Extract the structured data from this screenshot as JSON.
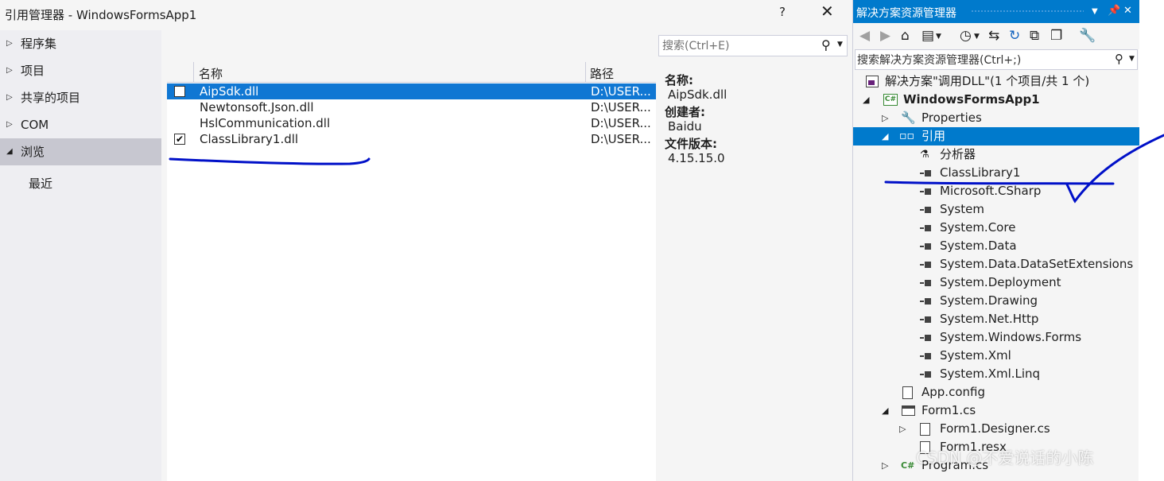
{
  "reference_manager": {
    "title": "引用管理器 - WindowsFormsApp1",
    "help_label": "?",
    "close_label": "✕",
    "nav": [
      {
        "label": "程序集",
        "arrow": "▷"
      },
      {
        "label": "项目",
        "arrow": "▷"
      },
      {
        "label": "共享的项目",
        "arrow": "▷"
      },
      {
        "label": "COM",
        "arrow": "▷"
      },
      {
        "label": "浏览",
        "arrow": "◢",
        "selected": true
      }
    ],
    "nav_sub": "最近",
    "columns": {
      "name": "名称",
      "path": "路径"
    },
    "rows": [
      {
        "name": "AipSdk.dll",
        "path": "D:\\USER...",
        "checked": false,
        "selected": true
      },
      {
        "name": "Newtonsoft.Json.dll",
        "path": "D:\\USER...",
        "checked": null,
        "selected": false
      },
      {
        "name": "HslCommunication.dll",
        "path": "D:\\USER...",
        "checked": null,
        "selected": false
      },
      {
        "name": "ClassLibrary1.dll",
        "path": "D:\\USER...",
        "checked": true,
        "selected": false
      }
    ],
    "search_placeholder": "搜索(Ctrl+E)",
    "details": {
      "name_label": "名称:",
      "name_value": "AipSdk.dll",
      "creator_label": "创建者:",
      "creator_value": "Baidu",
      "version_label": "文件版本:",
      "version_value": "4.15.15.0"
    }
  },
  "solution_explorer": {
    "title": "解决方案资源管理器",
    "search_placeholder": "搜索解决方案资源管理器(Ctrl+;)",
    "solution_label": "解决方案\"调用DLL\"(1 个项目/共 1 个)",
    "project_label": "WindowsFormsApp1",
    "properties_label": "Properties",
    "references_label": "引用",
    "analyzers_label": "分析器",
    "references": [
      "ClassLibrary1",
      "Microsoft.CSharp",
      "System",
      "System.Core",
      "System.Data",
      "System.Data.DataSetExtensions",
      "System.Deployment",
      "System.Drawing",
      "System.Net.Http",
      "System.Windows.Forms",
      "System.Xml",
      "System.Xml.Linq"
    ],
    "app_config": "App.config",
    "form1": "Form1.cs",
    "form1_designer": "Form1.Designer.cs",
    "form1_resx": "Form1.resx",
    "program": "Program.cs"
  },
  "watermark": "CSDN @不爱说话的小陈",
  "annotation_color": "#0010c8"
}
